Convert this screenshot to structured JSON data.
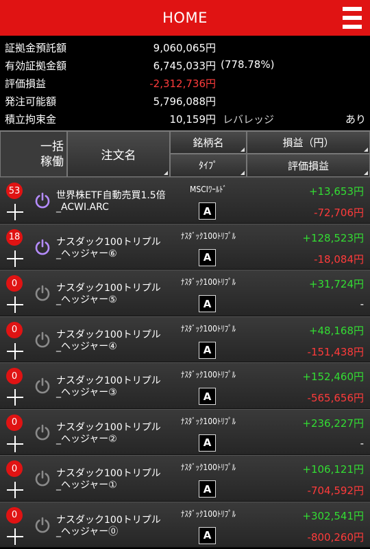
{
  "header": {
    "title": "HOME"
  },
  "summary": [
    {
      "label": "証拠金預託額",
      "value": "9,060,065円"
    },
    {
      "label": "有効証拠金額",
      "value": "6,745,033円",
      "pct": "(778.78%)"
    },
    {
      "label": "評価損益",
      "value": "-2,312,736円"
    },
    {
      "label": "発注可能額",
      "value": "5,796,088円"
    },
    {
      "label": "積立拘束金",
      "value": "10,159円",
      "lev_label": "レバレッジ",
      "lev_value": "あり"
    }
  ],
  "table_header": {
    "ikkatsu_1": "一括",
    "ikkatsu_2": "稼働",
    "order_name": "注文名",
    "brand": "銘柄名",
    "pl": "損益（円）",
    "type": "ﾀｲﾌﾟ",
    "eval": "評価損益"
  },
  "rows": [
    {
      "count": "53",
      "active": true,
      "name": "世界株ETF自動売買1.5倍\n_ACWI.ARC",
      "brand": "MSCIﾜｰﾙﾄﾞ",
      "type": "A",
      "pl": "+13,653円",
      "eval": "-72,706円"
    },
    {
      "count": "18",
      "active": true,
      "name": "ナスダック100トリプル\n_ヘッジャー⑥",
      "brand": "ﾅｽﾀﾞｯｸ100ﾄﾘﾌﾟﾙ",
      "type": "A",
      "pl": "+128,523円",
      "eval": "-18,084円"
    },
    {
      "count": "0",
      "active": false,
      "name": "ナスダック100トリプル\n_ヘッジャー⑤",
      "brand": "ﾅｽﾀﾞｯｸ100ﾄﾘﾌﾟﾙ",
      "type": "A",
      "pl": "+31,724円",
      "eval": "-"
    },
    {
      "count": "0",
      "active": false,
      "name": "ナスダック100トリプル\n_ヘッジャー④",
      "brand": "ﾅｽﾀﾞｯｸ100ﾄﾘﾌﾟﾙ",
      "type": "A",
      "pl": "+48,168円",
      "eval": "-151,438円"
    },
    {
      "count": "0",
      "active": false,
      "name": "ナスダック100トリプル\n_ヘッジャー③",
      "brand": "ﾅｽﾀﾞｯｸ100ﾄﾘﾌﾟﾙ",
      "type": "A",
      "pl": "+152,460円",
      "eval": "-565,656円"
    },
    {
      "count": "0",
      "active": false,
      "name": "ナスダック100トリプル\n_ヘッジャー②",
      "brand": "ﾅｽﾀﾞｯｸ100ﾄﾘﾌﾟﾙ",
      "type": "A",
      "pl": "+236,227円",
      "eval": "-"
    },
    {
      "count": "0",
      "active": false,
      "name": "ナスダック100トリプル\n_ヘッジャー①",
      "brand": "ﾅｽﾀﾞｯｸ100ﾄﾘﾌﾟﾙ",
      "type": "A",
      "pl": "+106,121円",
      "eval": "-704,592円"
    },
    {
      "count": "0",
      "active": false,
      "name": "ナスダック100トリプル\n_ヘッジャー⓪",
      "brand": "ﾅｽﾀﾞｯｸ100ﾄﾘﾌﾟﾙ",
      "type": "A",
      "pl": "+302,541円",
      "eval": "-800,260円"
    }
  ],
  "colors": {
    "brand_red": "#e01313",
    "positive": "#33dd33",
    "negative": "#ff3b3b",
    "power_active": "#b58cff",
    "power_inactive": "#8a8a8a"
  }
}
